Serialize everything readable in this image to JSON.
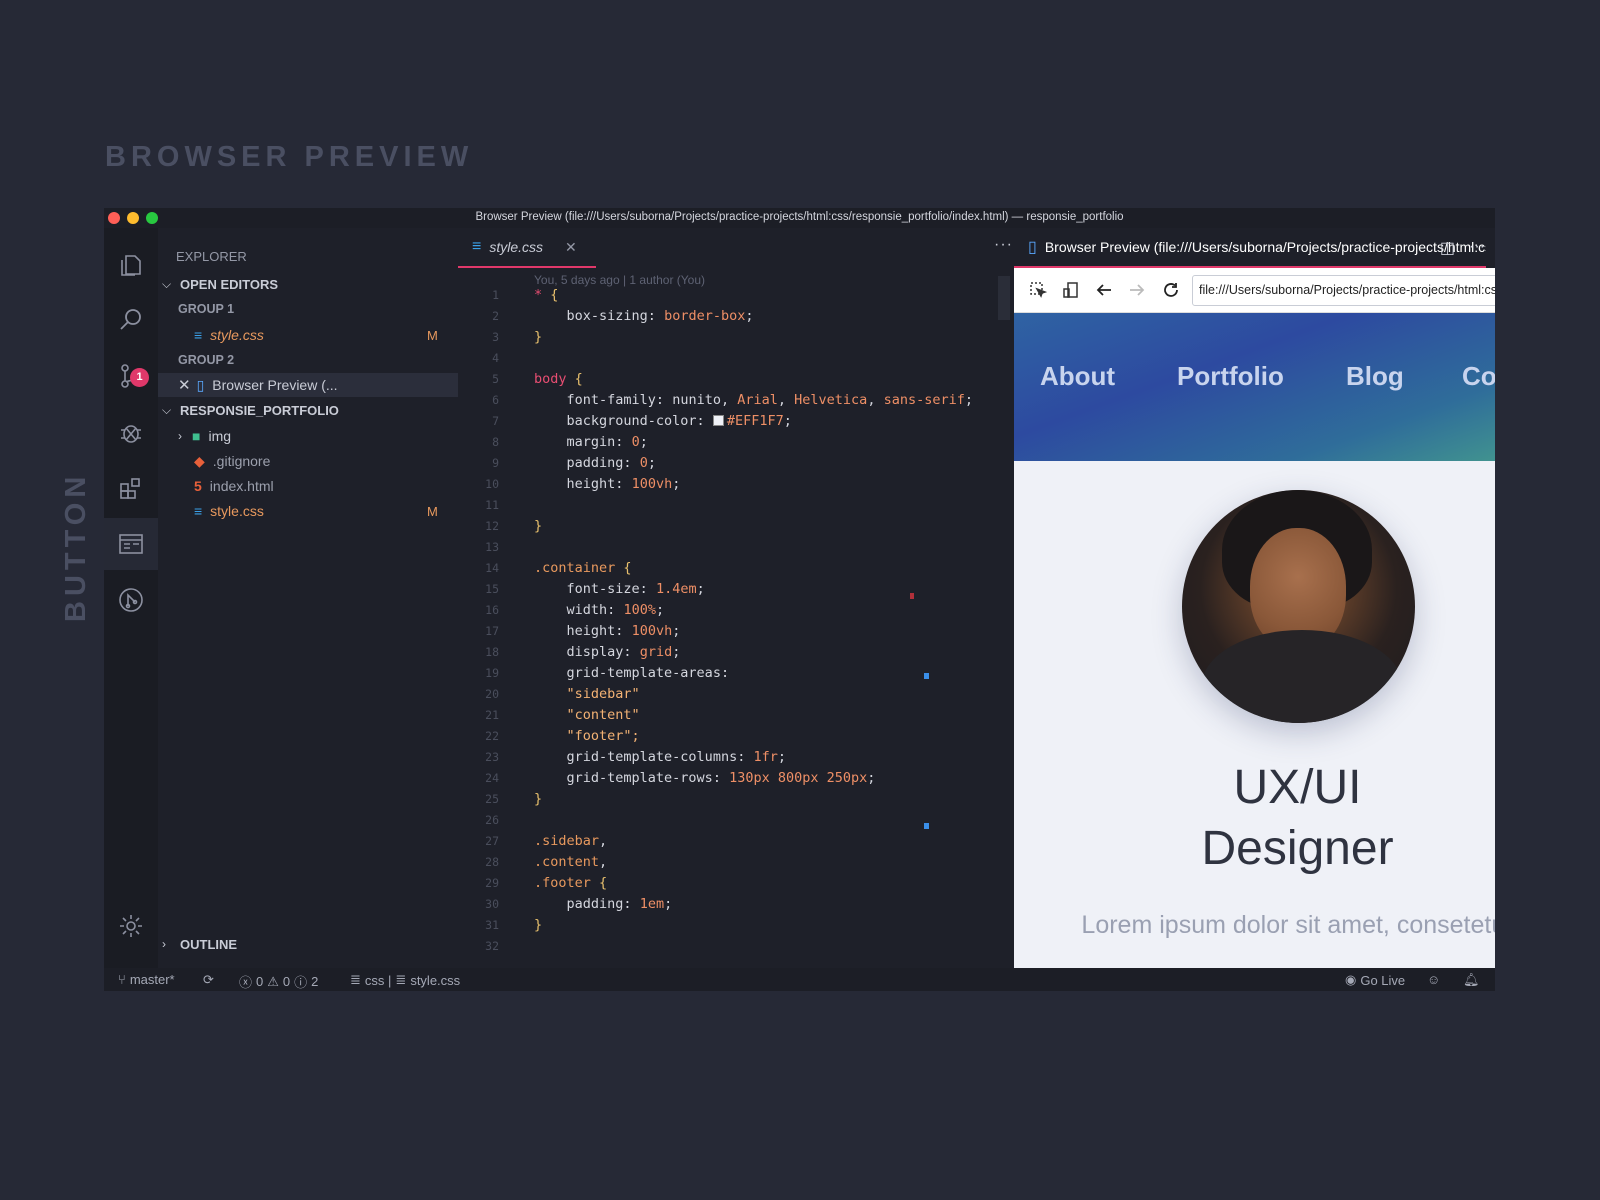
{
  "heading": "BROWSER PREVIEW",
  "side_label": "BUTTON",
  "window": {
    "title": "Browser Preview (file:///Users/suborna/Projects/practice-projects/html:css/responsie_portfolio/index.html) — responsie_portfolio"
  },
  "activity_bar": {
    "scm_badge": "1"
  },
  "explorer": {
    "title": "EXPLORER",
    "open_editors": "OPEN EDITORS",
    "group1": "GROUP 1",
    "group1_file": "style.css",
    "group1_file_status": "M",
    "group2": "GROUP 2",
    "group2_file": "Browser Preview (...",
    "project": "RESPONSIE_PORTFOLIO",
    "files": [
      {
        "name": "img"
      },
      {
        "name": ".gitignore"
      },
      {
        "name": "index.html"
      },
      {
        "name": "style.css",
        "status": "M"
      }
    ],
    "outline": "OUTLINE"
  },
  "editor": {
    "tab_label": "style.css",
    "blame": "You, 5 days ago | 1 author (You)",
    "code": [
      {
        "n": "1",
        "t": "* {"
      },
      {
        "n": "2",
        "t": "    box-sizing: border-box;"
      },
      {
        "n": "3",
        "t": "}"
      },
      {
        "n": "4",
        "t": ""
      },
      {
        "n": "5",
        "t": "body {"
      },
      {
        "n": "6",
        "t": "    font-family: nunito, Arial, Helvetica, sans-serif;"
      },
      {
        "n": "7",
        "t": "    background-color: #EFF1F7;"
      },
      {
        "n": "8",
        "t": "    margin: 0;"
      },
      {
        "n": "9",
        "t": "    padding: 0;"
      },
      {
        "n": "10",
        "t": "    height: 100vh;"
      },
      {
        "n": "11",
        "t": ""
      },
      {
        "n": "12",
        "t": "}"
      },
      {
        "n": "13",
        "t": ""
      },
      {
        "n": "14",
        "t": ".container {"
      },
      {
        "n": "15",
        "t": "    font-size: 1.4em;"
      },
      {
        "n": "16",
        "t": "    width: 100%;"
      },
      {
        "n": "17",
        "t": "    height: 100vh;"
      },
      {
        "n": "18",
        "t": "    display: grid;"
      },
      {
        "n": "19",
        "t": "    grid-template-areas:"
      },
      {
        "n": "20",
        "t": "    \"sidebar\""
      },
      {
        "n": "21",
        "t": "    \"content\""
      },
      {
        "n": "22",
        "t": "    \"footer\";"
      },
      {
        "n": "23",
        "t": "    grid-template-columns: 1fr;"
      },
      {
        "n": "24",
        "t": "    grid-template-rows: 130px 800px 250px;"
      },
      {
        "n": "25",
        "t": "}"
      },
      {
        "n": "26",
        "t": ""
      },
      {
        "n": "27",
        "t": ".sidebar,"
      },
      {
        "n": "28",
        "t": ".content,"
      },
      {
        "n": "29",
        "t": ".footer {"
      },
      {
        "n": "30",
        "t": "    padding: 1em;"
      },
      {
        "n": "31",
        "t": "}"
      },
      {
        "n": "32",
        "t": ""
      }
    ]
  },
  "preview": {
    "tab_label": "Browser Preview (file:///Users/suborna/Projects/practice-projects/html:css/responsie_portfolio/index.html)",
    "url": "file:///Users/suborna/Projects/practice-projects/html:css/responsie_portfolio/index.html",
    "nav": [
      "About",
      "Portfolio",
      "Blog",
      "Contact"
    ],
    "hero_line1": "UX/UI",
    "hero_line2": "Designer",
    "lorem": "Lorem ipsum dolor sit amet, consetetur"
  },
  "statusbar": {
    "branch": "master*",
    "errors": "0",
    "warnings": "0",
    "infos": "2",
    "lang": "css | ",
    "file": "style.css",
    "go_live": "Go Live"
  },
  "colors": {
    "accent": "#e0386a",
    "modified": "#e8995e",
    "site_bg": "#EFF1F7"
  }
}
